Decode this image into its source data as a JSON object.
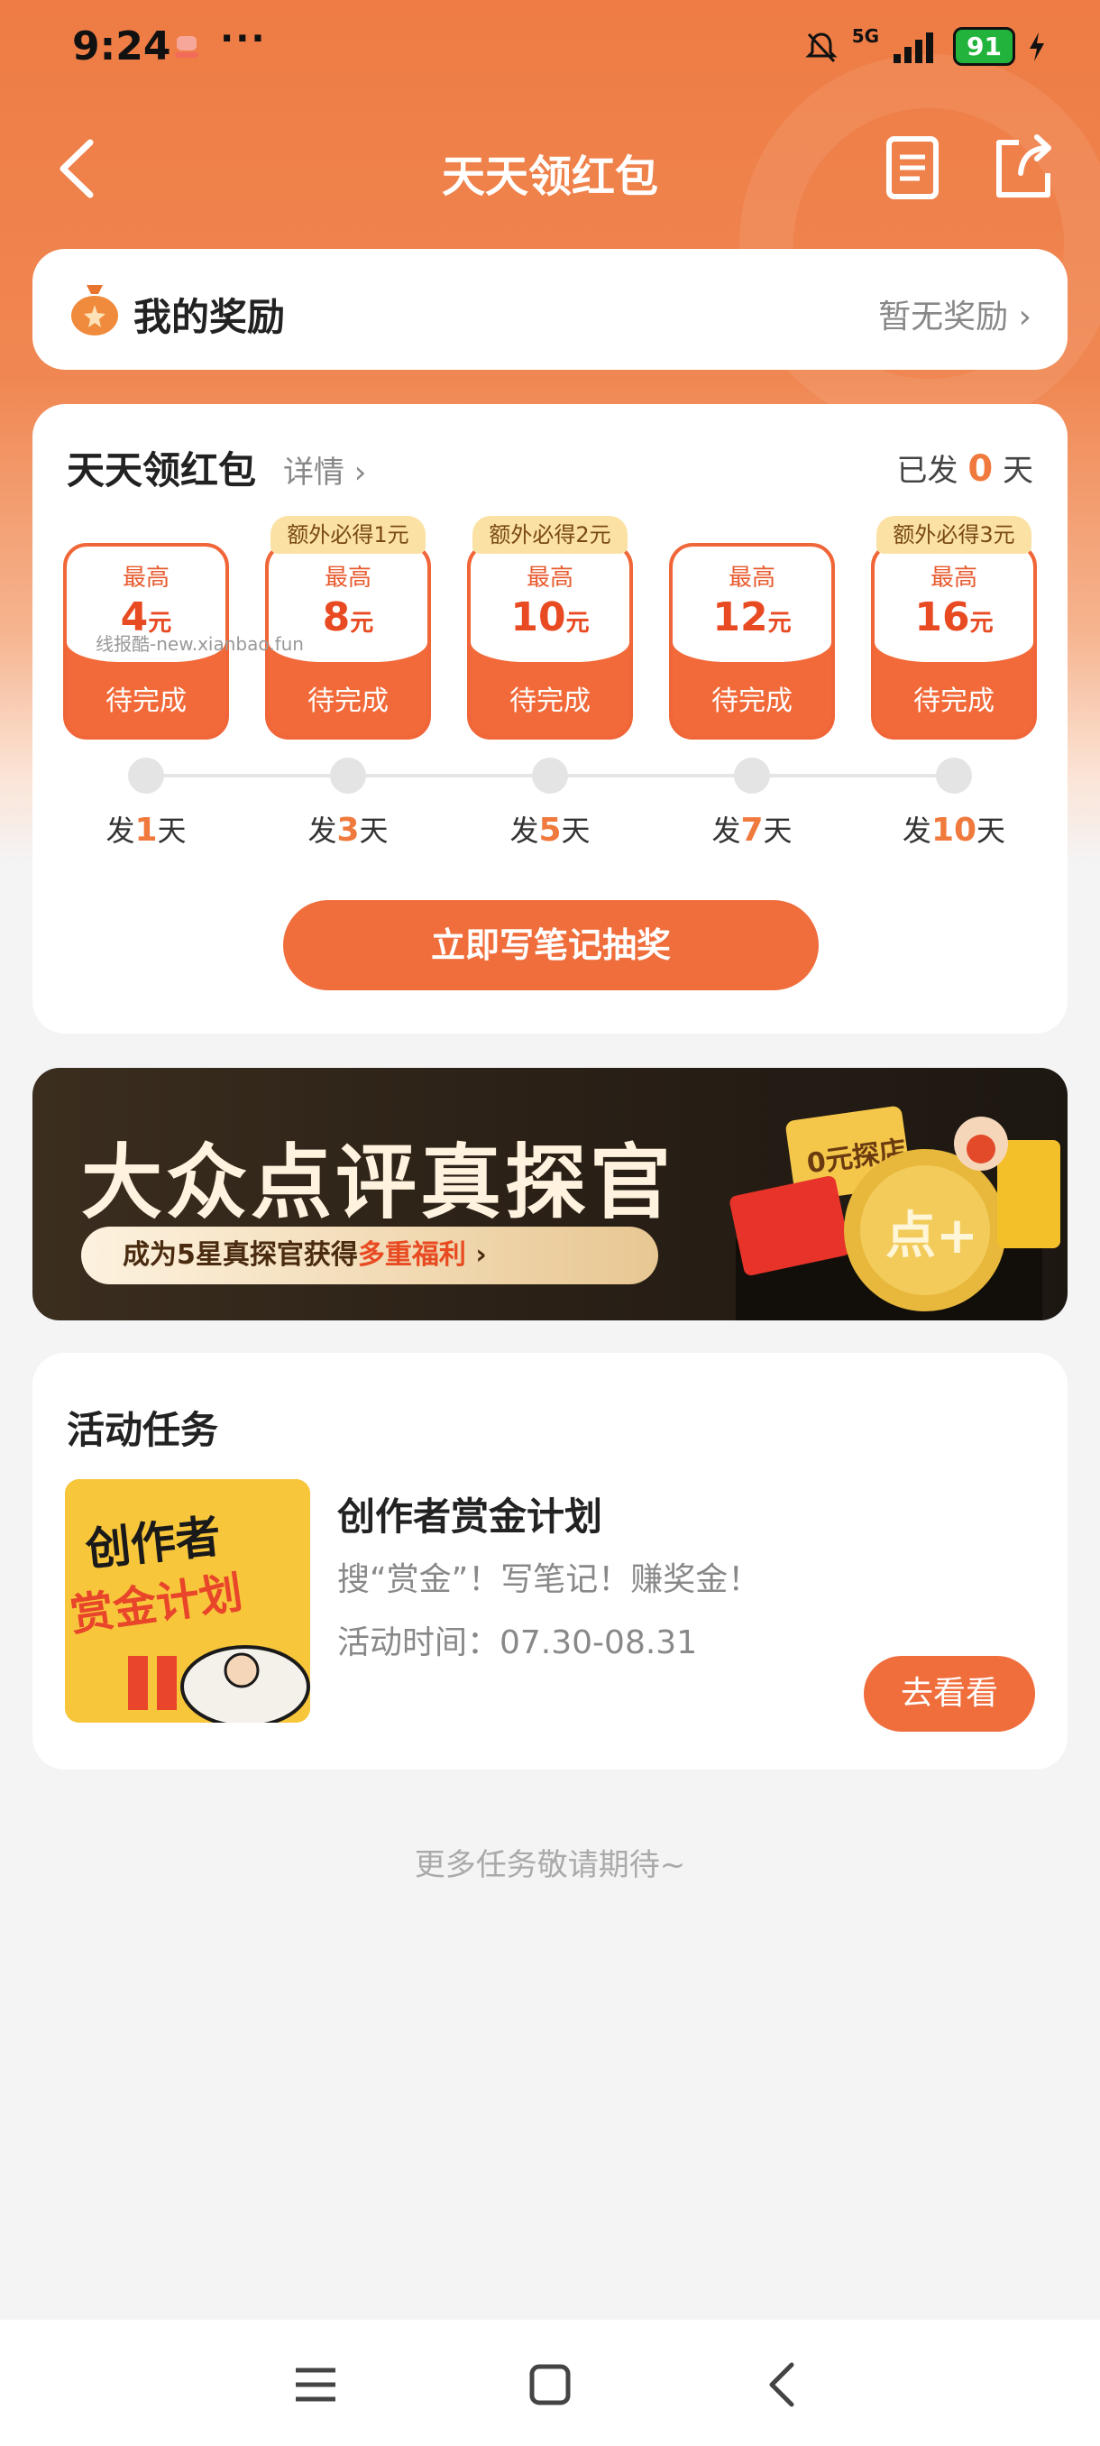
{
  "status_bar": {
    "time": "9:24",
    "more": "···",
    "network": "5G",
    "battery": "91"
  },
  "nav": {
    "title": "天天领红包"
  },
  "reward": {
    "title": "我的奖励",
    "status": "暂无奖励 ›"
  },
  "daily": {
    "title": "天天领红包",
    "details": "详情 ›",
    "sent_prefix": "已发",
    "sent_count": "0",
    "sent_suffix": "天",
    "watermark": "线报酷-new.xianbao.fun",
    "slots": [
      {
        "extra": "",
        "label": "最高",
        "amount": "4",
        "unit": "元",
        "status": "待完成",
        "day_prefix": "发",
        "day_num": "1",
        "day_suffix": "天"
      },
      {
        "extra": "额外必得1元",
        "label": "最高",
        "amount": "8",
        "unit": "元",
        "status": "待完成",
        "day_prefix": "发",
        "day_num": "3",
        "day_suffix": "天"
      },
      {
        "extra": "额外必得2元",
        "label": "最高",
        "amount": "10",
        "unit": "元",
        "status": "待完成",
        "day_prefix": "发",
        "day_num": "5",
        "day_suffix": "天"
      },
      {
        "extra": "",
        "label": "最高",
        "amount": "12",
        "unit": "元",
        "status": "待完成",
        "day_prefix": "发",
        "day_num": "7",
        "day_suffix": "天"
      },
      {
        "extra": "额外必得3元",
        "label": "最高",
        "amount": "16",
        "unit": "元",
        "status": "待完成",
        "day_prefix": "发",
        "day_num": "10",
        "day_suffix": "天"
      }
    ],
    "cta": "立即写笔记抽奖"
  },
  "banner": {
    "title": "大众点评真探官",
    "pill_prefix": "成为5星真探官获得",
    "pill_highlight": "多重福利",
    "pill_arrow": "›",
    "art_tag": "0元探店",
    "coin_text": "点+"
  },
  "tasks": {
    "title": "活动任务",
    "items": [
      {
        "thumb_line1": "创作者",
        "thumb_line2": "赏金计划",
        "name": "创作者赏金计划",
        "desc": "搜“赏金”！写笔记！赚奖金！",
        "time": "活动时间：07.30-08.31",
        "button": "去看看"
      }
    ],
    "more": "更多任务敬请期待~"
  },
  "colors": {
    "accent": "#f06d3c",
    "header": "#ee7c44",
    "extra_badge": "#fbe2a4"
  }
}
